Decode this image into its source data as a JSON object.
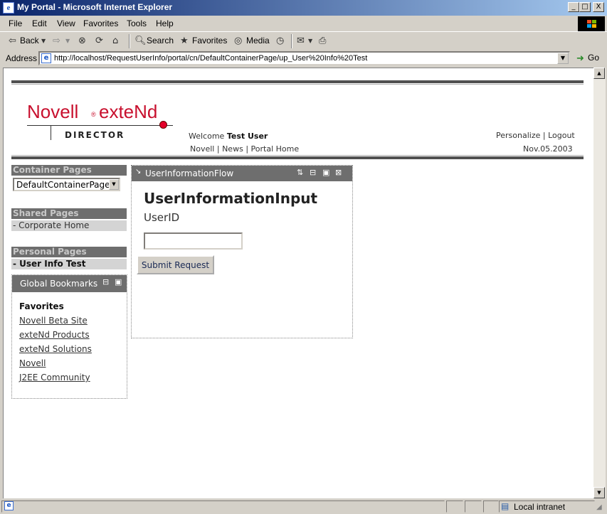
{
  "window": {
    "title": "My Portal - Microsoft Internet Explorer",
    "ie_glyph": "e",
    "min": "_",
    "max": "□",
    "close": "X"
  },
  "menu": [
    "File",
    "Edit",
    "View",
    "Favorites",
    "Tools",
    "Help"
  ],
  "toolbar": {
    "back": "Back",
    "search": "Search",
    "favorites": "Favorites",
    "media": "Media"
  },
  "address": {
    "label": "Address",
    "url": "http://localhost/RequestUserInfo/portal/cn/DefaultContainerPage/up_User%20Info%20Test",
    "go": "Go"
  },
  "header": {
    "logo_novell": "Novell",
    "logo_extend": "exteNd",
    "logo_product": "DIRECTOR",
    "welcome_prefix": "Welcome",
    "user": "Test User",
    "links": [
      "Novell",
      "News",
      "Portal Home"
    ],
    "personalize": "Personalize",
    "logout": "Logout",
    "date": "Nov.05.2003",
    "separator": "|"
  },
  "sidebar": {
    "container_pages_label": "Container Pages",
    "container_select_value": "DefaultContainerPage",
    "shared_pages_label": "Shared Pages",
    "shared_pages": [
      "- Corporate Home"
    ],
    "personal_pages_label": "Personal Pages",
    "personal_pages": [
      "- User Info Test"
    ],
    "bookmarks_title": "Global Bookmarks",
    "favorites_heading": "Favorites",
    "bookmarks": [
      "Novell Beta Site",
      "exteNd Products",
      "exteNd Solutions",
      "Novell",
      "J2EE Community"
    ]
  },
  "portlet": {
    "title": "UserInformationFlow",
    "form_heading": "UserInformationInput",
    "field_label": "UserID",
    "field_value": "",
    "submit": "Submit Request"
  },
  "status": {
    "zone": "Local intranet"
  },
  "colors": {
    "titlebar_start": "#0a246a",
    "titlebar_end": "#a6caf0",
    "brand_red": "#c8102e",
    "header_gray": "#6e6e6e"
  }
}
